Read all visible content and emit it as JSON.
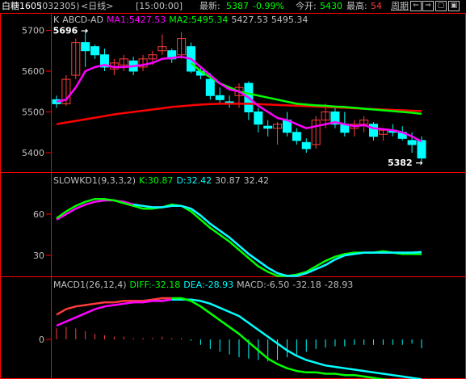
{
  "topbar": {
    "name": "白糖1605",
    "code": "(032305)",
    "period": "<日线>",
    "time": "[15:00:00]",
    "latest_label": "最新:",
    "latest_value": "5387",
    "change": "-0.99%",
    "open_label": "今开:",
    "open_value": "5430",
    "high_label": "最高:",
    "high_value": "54",
    "period_button": "周期",
    "nav_buttons": [
      "⇐",
      "⇒",
      "▢",
      "▣"
    ]
  },
  "colors": {
    "up": "#ff3c3c",
    "down": "#00ffff",
    "ma1": "#ff00ff",
    "ma2": "#00ff00",
    "ma3": "#ff0000",
    "label_white": "#c0c0c0",
    "frame": "#ff0000"
  },
  "main_panel": {
    "k_label": "K",
    "symbol": "ABCD-AD",
    "ma1_text": "MA1:5427.53",
    "ma2_text": "MA2:5495.34",
    "extra1": "5427.53",
    "extra2": "5495.34",
    "y_ticks": [
      "5700",
      "5600",
      "5500",
      "5400"
    ],
    "high_marker": "5696",
    "low_marker": "5382"
  },
  "kd_panel": {
    "name": "SLOWKD1(9,3,3,2)",
    "k_text": "K:30.87",
    "d_text": "D:32.42",
    "extra1": "30.87",
    "extra2": "32.42",
    "y_ticks": [
      "60",
      "30"
    ]
  },
  "macd_panel": {
    "name": "MACD1(26,12,4)",
    "diff_text": "DIFF:-32.18",
    "dea_text": "DEA:-28.93",
    "macd_text": "MACD:-6.50",
    "extra1": "-32.18",
    "extra2": "-28.93",
    "y_ticks": [
      "0"
    ]
  },
  "chart_data": {
    "type": "candlestick",
    "candles": [
      {
        "o": 5530,
        "h": 5540,
        "l": 5510,
        "c": 5520
      },
      {
        "o": 5520,
        "h": 5590,
        "l": 5515,
        "c": 5580
      },
      {
        "o": 5590,
        "h": 5680,
        "l": 5580,
        "c": 5670
      },
      {
        "o": 5670,
        "h": 5700,
        "l": 5610,
        "c": 5650
      },
      {
        "o": 5660,
        "h": 5665,
        "l": 5630,
        "c": 5640
      },
      {
        "o": 5640,
        "h": 5655,
        "l": 5600,
        "c": 5610
      },
      {
        "o": 5605,
        "h": 5630,
        "l": 5590,
        "c": 5620
      },
      {
        "o": 5615,
        "h": 5640,
        "l": 5600,
        "c": 5630
      },
      {
        "o": 5625,
        "h": 5635,
        "l": 5590,
        "c": 5600
      },
      {
        "o": 5610,
        "h": 5640,
        "l": 5600,
        "c": 5630
      },
      {
        "o": 5630,
        "h": 5650,
        "l": 5615,
        "c": 5640
      },
      {
        "o": 5650,
        "h": 5690,
        "l": 5640,
        "c": 5660
      },
      {
        "o": 5650,
        "h": 5655,
        "l": 5620,
        "c": 5630
      },
      {
        "o": 5640,
        "h": 5696,
        "l": 5630,
        "c": 5680
      },
      {
        "o": 5660,
        "h": 5670,
        "l": 5595,
        "c": 5600
      },
      {
        "o": 5600,
        "h": 5610,
        "l": 5580,
        "c": 5590
      },
      {
        "o": 5580,
        "h": 5595,
        "l": 5530,
        "c": 5540
      },
      {
        "o": 5540,
        "h": 5560,
        "l": 5520,
        "c": 5530
      },
      {
        "o": 5525,
        "h": 5540,
        "l": 5510,
        "c": 5520
      },
      {
        "o": 5540,
        "h": 5570,
        "l": 5510,
        "c": 5560
      },
      {
        "o": 5570,
        "h": 5575,
        "l": 5480,
        "c": 5500
      },
      {
        "o": 5500,
        "h": 5510,
        "l": 5450,
        "c": 5470
      },
      {
        "o": 5465,
        "h": 5480,
        "l": 5440,
        "c": 5460
      },
      {
        "o": 5460,
        "h": 5475,
        "l": 5420,
        "c": 5470
      },
      {
        "o": 5480,
        "h": 5500,
        "l": 5440,
        "c": 5450
      },
      {
        "o": 5450,
        "h": 5460,
        "l": 5420,
        "c": 5430
      },
      {
        "o": 5425,
        "h": 5435,
        "l": 5400,
        "c": 5410
      },
      {
        "o": 5420,
        "h": 5490,
        "l": 5410,
        "c": 5480
      },
      {
        "o": 5480,
        "h": 5520,
        "l": 5460,
        "c": 5500
      },
      {
        "o": 5500,
        "h": 5510,
        "l": 5460,
        "c": 5470
      },
      {
        "o": 5470,
        "h": 5500,
        "l": 5440,
        "c": 5450
      },
      {
        "o": 5460,
        "h": 5480,
        "l": 5440,
        "c": 5470
      },
      {
        "o": 5470,
        "h": 5490,
        "l": 5450,
        "c": 5480
      },
      {
        "o": 5470,
        "h": 5475,
        "l": 5430,
        "c": 5440
      },
      {
        "o": 5445,
        "h": 5460,
        "l": 5430,
        "c": 5455
      },
      {
        "o": 5455,
        "h": 5470,
        "l": 5440,
        "c": 5450
      },
      {
        "o": 5450,
        "h": 5465,
        "l": 5430,
        "c": 5435
      },
      {
        "o": 5430,
        "h": 5450,
        "l": 5400,
        "c": 5420
      },
      {
        "o": 5430,
        "h": 5440,
        "l": 5380,
        "c": 5387
      }
    ],
    "ma1": [
      5525,
      5530,
      5560,
      5600,
      5610,
      5615,
      5610,
      5610,
      5612,
      5615,
      5620,
      5630,
      5632,
      5635,
      5630,
      5610,
      5590,
      5570,
      5555,
      5550,
      5535,
      5515,
      5500,
      5485,
      5480,
      5470,
      5460,
      5465,
      5470,
      5475,
      5470,
      5465,
      5468,
      5460,
      5458,
      5455,
      5450,
      5440,
      5427.53
    ],
    "ma2": [
      null,
      null,
      null,
      null,
      null,
      null,
      null,
      null,
      null,
      null,
      null,
      null,
      null,
      null,
      5620,
      5600,
      5585,
      5570,
      5560,
      5550,
      5545,
      5540,
      5535,
      5530,
      5525,
      5520,
      5518,
      5516,
      5515,
      5513,
      5512,
      5510,
      5508,
      5506,
      5504,
      5502,
      5500,
      5498,
      5495.34
    ],
    "ma3": [
      5470,
      5474,
      5478,
      5482,
      5486,
      5490,
      5494,
      5497,
      5500,
      5503,
      5506,
      5509,
      5512,
      5514,
      5516,
      5518,
      5519,
      5520,
      5520,
      5520,
      5520,
      5519,
      5518,
      5517,
      5516,
      5515,
      5514,
      5513,
      5512,
      5511,
      5510,
      5509,
      5508,
      5507,
      5506,
      5505,
      5504,
      5503,
      5502
    ],
    "kd_k": [
      57,
      62,
      66,
      69,
      71,
      71,
      70,
      68,
      66,
      64,
      64,
      65,
      67,
      66,
      62,
      56,
      50,
      45,
      40,
      34,
      28,
      22,
      18,
      15,
      15,
      16,
      18,
      22,
      26,
      29,
      31,
      32,
      32,
      32,
      33,
      32,
      31,
      31,
      30.87
    ],
    "kd_d": [
      56,
      60,
      64,
      67,
      69,
      70,
      70,
      69,
      67,
      66,
      65,
      65,
      66,
      66,
      64,
      59,
      53,
      48,
      43,
      37,
      31,
      26,
      21,
      17,
      15,
      15,
      17,
      20,
      23,
      27,
      30,
      31,
      32,
      32,
      32,
      32,
      32,
      32,
      32.42
    ],
    "macd_diff": [
      18,
      22,
      24,
      25,
      26,
      27,
      27,
      28,
      28,
      28,
      29,
      30,
      30,
      30,
      28,
      24,
      19,
      14,
      9,
      4,
      -2,
      -8,
      -14,
      -18,
      -21,
      -23,
      -24,
      -24,
      -25,
      -25,
      -26,
      -26,
      -27,
      -28,
      -29,
      -30,
      -31,
      -31,
      -32.18
    ],
    "macd_dea": [
      10,
      13,
      16,
      19,
      22,
      24,
      25,
      26,
      27,
      27,
      28,
      28,
      29,
      29,
      29,
      28,
      26,
      23,
      20,
      17,
      12,
      7,
      2,
      -3,
      -8,
      -12,
      -15,
      -17,
      -19,
      -20,
      -21,
      -22,
      -23,
      -24,
      -25,
      -26,
      -27,
      -28,
      -28.93
    ],
    "macd_hist": [
      8,
      9,
      8,
      6,
      4,
      3,
      2,
      2,
      1,
      1,
      1,
      2,
      1,
      1,
      -1,
      -4,
      -7,
      -9,
      -11,
      -13,
      -14,
      -15,
      -16,
      -15,
      -13,
      -11,
      -9,
      -7,
      -6,
      -5,
      -5,
      -4,
      -4,
      -4,
      -4,
      -4,
      -4,
      -3,
      -6.5
    ]
  }
}
